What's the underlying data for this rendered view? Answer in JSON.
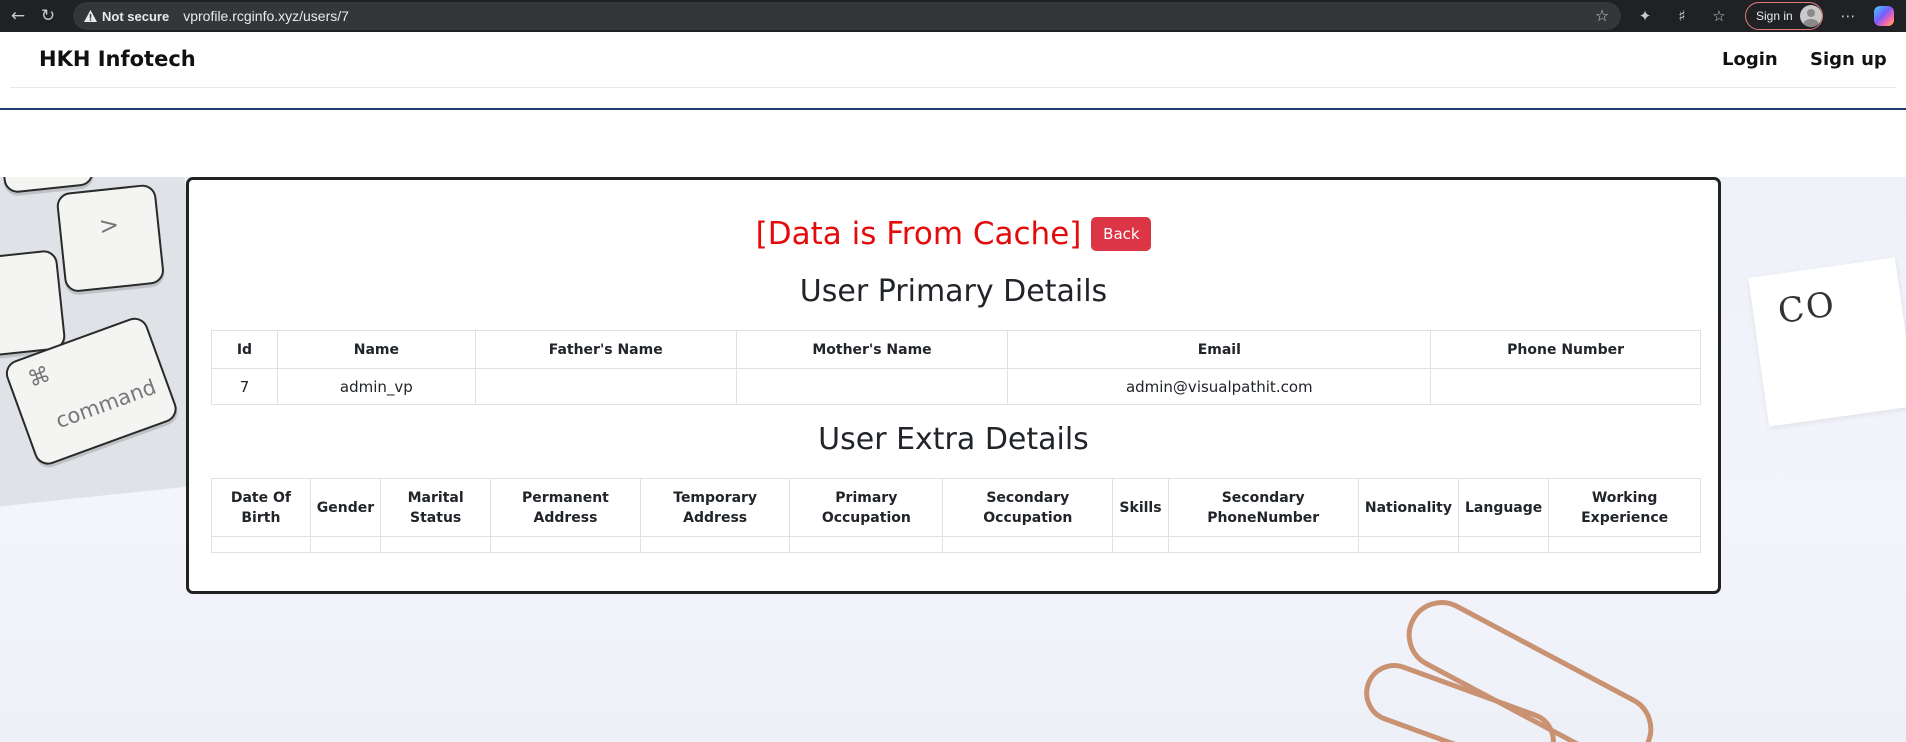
{
  "browser": {
    "security_label": "Not secure",
    "url": "vprofile.rcginfo.xyz/users/7",
    "signin_label": "Sign in"
  },
  "navbar": {
    "brand": "HKH Infotech",
    "login": "Login",
    "signup": "Sign up"
  },
  "main": {
    "cache_title": "[Data is From Cache]",
    "back_label": "Back",
    "primary_title": "User Primary Details",
    "extra_title": "User Extra Details"
  },
  "primary_table": {
    "headers": [
      "Id",
      "Name",
      "Father's Name",
      "Mother's Name",
      "Email",
      "Phone Number"
    ],
    "rows": [
      [
        "7",
        "admin_vp",
        "",
        "",
        "admin@visualpathit.com",
        ""
      ]
    ]
  },
  "extra_table": {
    "headers": [
      "Date Of Birth",
      "Gender",
      "Marital Status",
      "Permanent Address",
      "Temporary Address",
      "Primary Occupation",
      "Secondary Occupation",
      "Skills",
      "Secondary PhoneNumber",
      "Nationality",
      "Language",
      "Working Experience"
    ],
    "rows": [
      [
        "",
        "",
        "",
        "",
        "",
        "",
        "",
        "",
        "",
        "",
        "",
        ""
      ]
    ]
  },
  "background": {
    "key_labels": [
      "command",
      "⌘",
      ">",
      "<"
    ],
    "card_text": "CO"
  },
  "colors": {
    "cache_title": "#e30b0b",
    "back_button": "#dc3545",
    "rule": "#1d3b6e"
  }
}
